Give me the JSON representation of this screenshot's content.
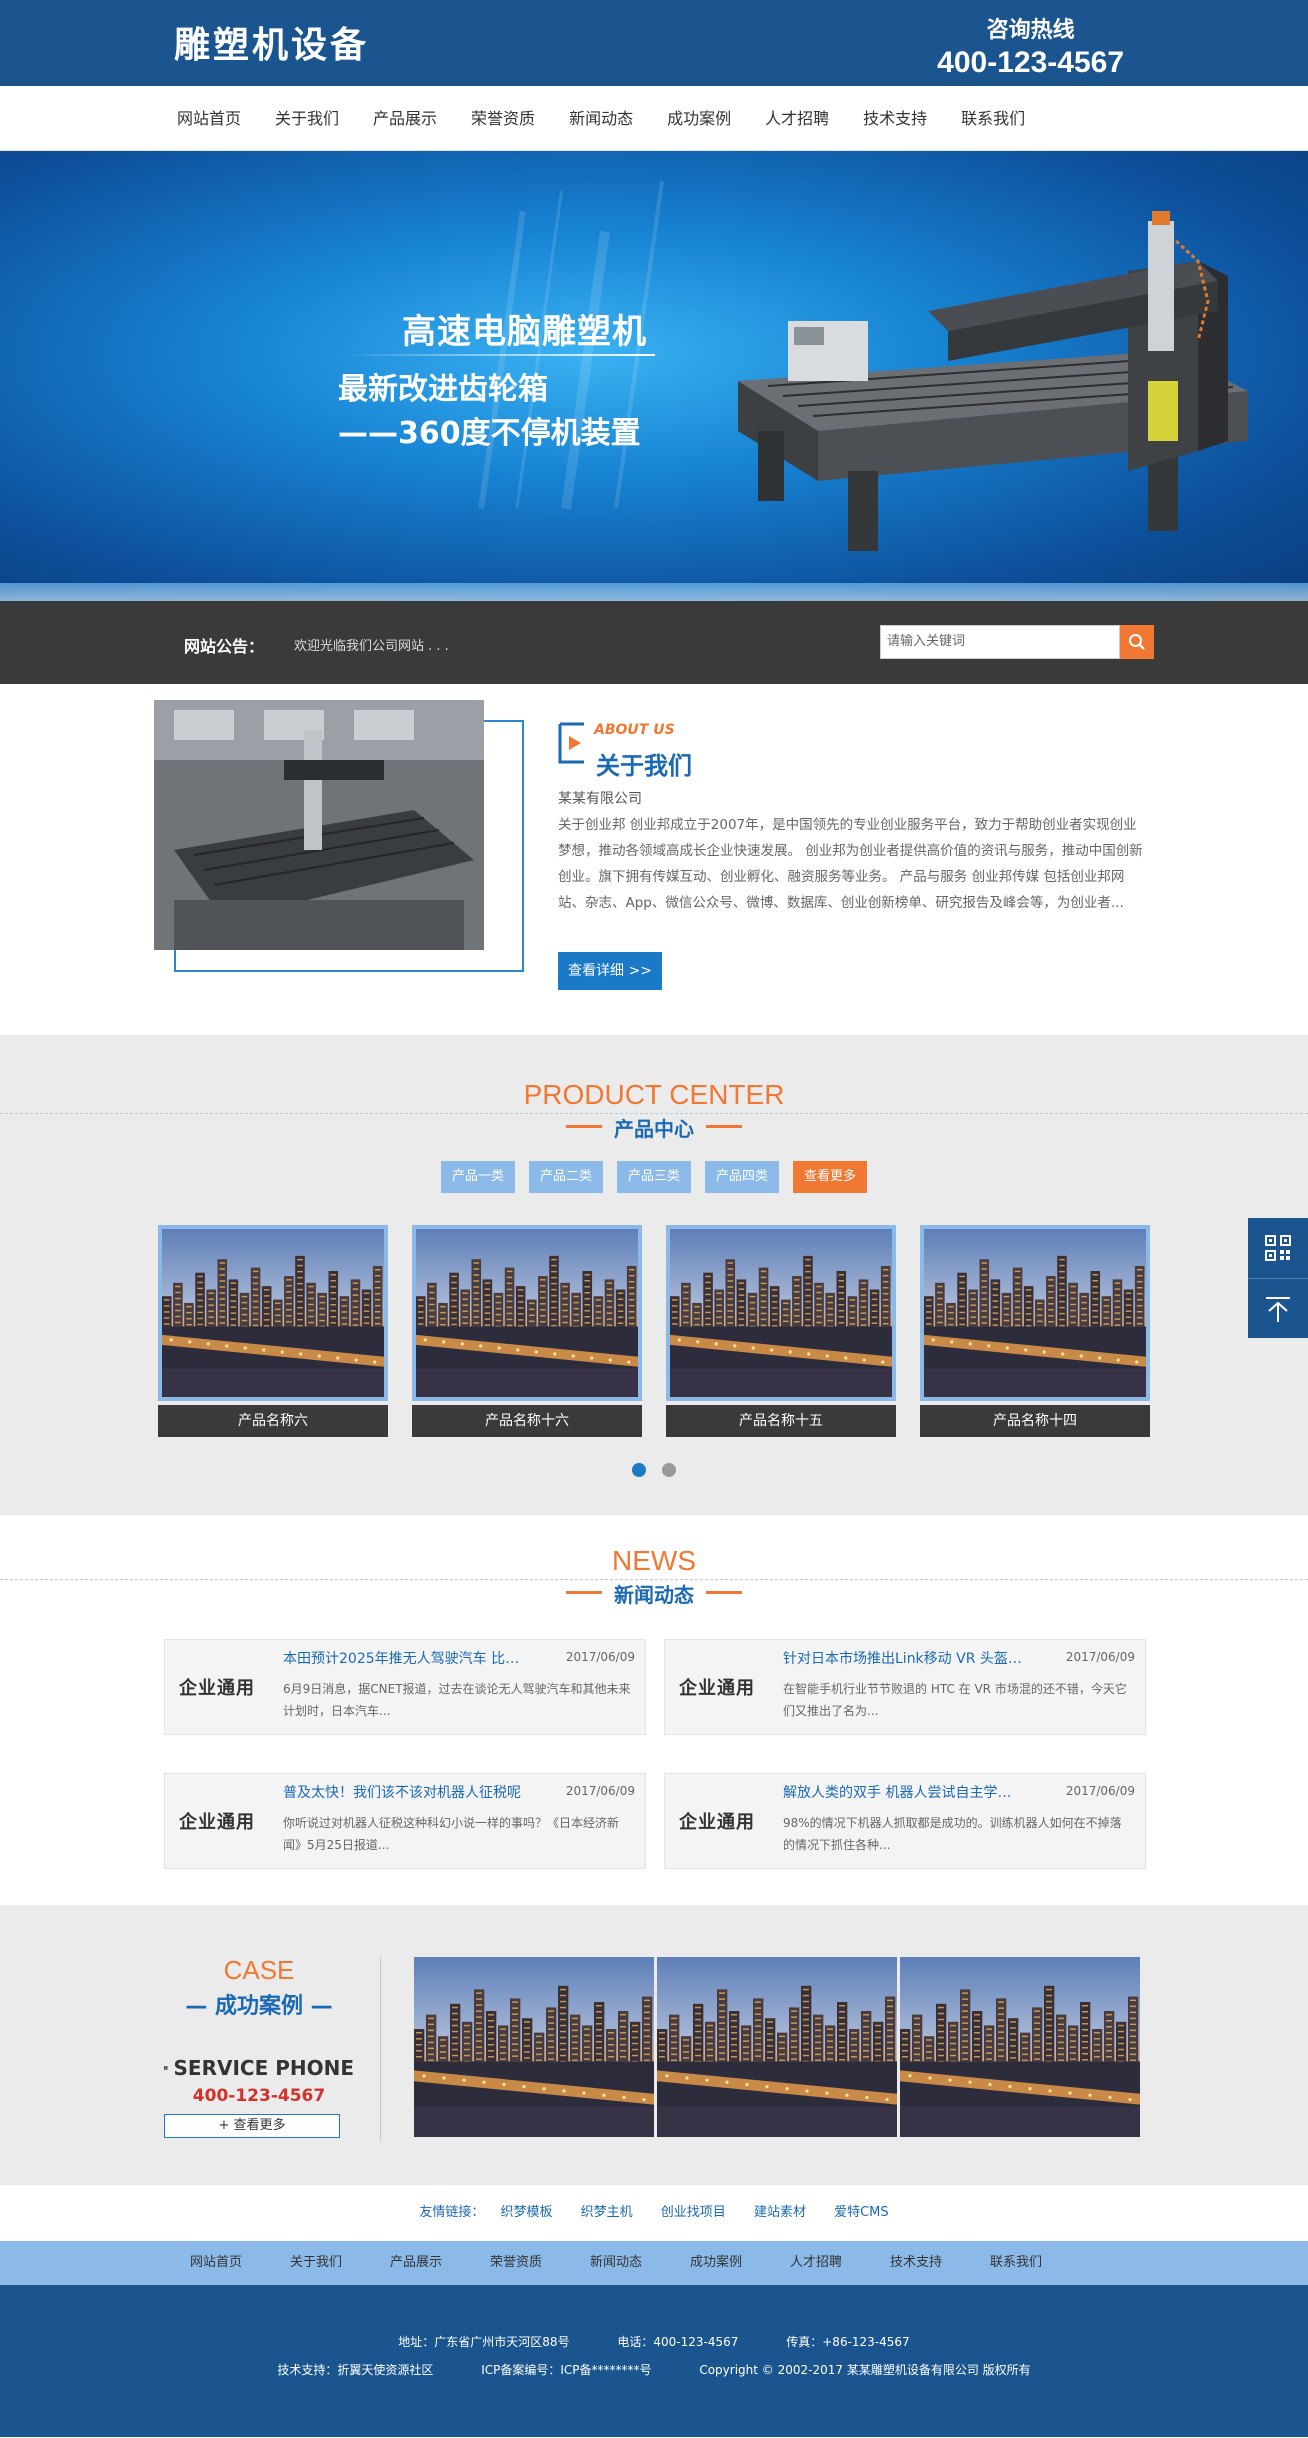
{
  "header": {
    "logo": "雕塑机设备",
    "hotline_label": "咨询热线",
    "hotline_number": "400-123-4567"
  },
  "nav": {
    "items": [
      "网站首页",
      "关于我们",
      "产品展示",
      "荣誉资质",
      "新闻动态",
      "成功案例",
      "人才招聘",
      "技术支持",
      "联系我们"
    ]
  },
  "banner": {
    "line1": "高速电脑雕塑机",
    "line2": "最新改进齿轮箱",
    "line3": "——360度不停机装置"
  },
  "notice": {
    "label": "网站公告：",
    "text": "欢迎光临我们公司网站 . . .",
    "search_placeholder": "请输入关键词"
  },
  "about": {
    "title_en": "ABOUT US",
    "title_zh": "关于我们",
    "company": "某某有限公司",
    "desc": "关于创业邦 创业邦成立于2007年，是中国领先的专业创业服务平台，致力于帮助创业者实现创业梦想，推动各领域高成长企业快速发展。 创业邦为创业者提供高价值的资讯与服务，推动中国创新创业。旗下拥有传媒互动、创业孵化、融资服务等业务。 产品与服务 创业邦传媒 包括创业邦网站、杂志、App、微信公众号、微博、数据库、创业创新榜单、研究报告及峰会等，为创业者...",
    "more": "查看详细 >>"
  },
  "products": {
    "title_en": "PRODUCT CENTER",
    "title_zh": "产品中心",
    "categories": [
      "产品一类",
      "产品二类",
      "产品三类",
      "产品四类"
    ],
    "more": "查看更多",
    "items": [
      {
        "name": "产品名称六"
      },
      {
        "name": "产品名称十六"
      },
      {
        "name": "产品名称十五"
      },
      {
        "name": "产品名称十四"
      }
    ],
    "slides": 2,
    "active_slide": 1
  },
  "news": {
    "title_en": "NEWS",
    "title_zh": "新闻动态",
    "logo_text": "企业通用",
    "items": [
      {
        "title": "本田预计2025年推无人驾驶汽车 比…",
        "date": "2017/06/09",
        "summary": "6月9日消息，据CNET报道，过去在谈论无人驾驶汽车和其他未来计划时，日本汽车..."
      },
      {
        "title": "针对日本市场推出Link移动 VR 头盔…",
        "date": "2017/06/09",
        "summary": "在智能手机行业节节败退的 HTC 在 VR 市场混的还不错，今天它们又推出了名为..."
      },
      {
        "title": "普及太快！我们该不该对机器人征税呢",
        "date": "2017/06/09",
        "summary": "你听说过对机器人征税这种科幻小说一样的事吗？《日本经济新闻》5月25日报道..."
      },
      {
        "title": "解放人类的双手 机器人尝试自主学…",
        "date": "2017/06/09",
        "summary": "98%的情况下机器人抓取都是成功的。训练机器人如何在不掉落的情况下抓住各种..."
      }
    ]
  },
  "case": {
    "title_en": "CASE",
    "title_zh": "— 成功案例 —",
    "phone_label": "SERVICE PHONE",
    "phone": "400-123-4567",
    "more": "+ 查看更多"
  },
  "links": {
    "label": "友情链接：",
    "items": [
      "织梦模板",
      "织梦主机",
      "创业找项目",
      "建站素材",
      "爱特CMS"
    ]
  },
  "footer_nav": {
    "items": [
      "网站首页",
      "关于我们",
      "产品展示",
      "荣誉资质",
      "新闻动态",
      "成功案例",
      "人才招聘",
      "技术支持",
      "联系我们"
    ]
  },
  "footer": {
    "address": "地址：广东省广州市天河区88号",
    "tel": "电话：400-123-4567",
    "fax": "传真：+86-123-4567",
    "support": "技术支持：折翼天使资源社区",
    "icp": "ICP备案编号：ICP备********号",
    "copyright": "Copyright © 2002-2017 某某雕塑机设备有限公司 版权所有"
  },
  "colors": {
    "brand_blue": "#1a5590",
    "accent_orange": "#f07832",
    "link_blue": "#1a69b4",
    "light_blue": "#8cbae8"
  }
}
